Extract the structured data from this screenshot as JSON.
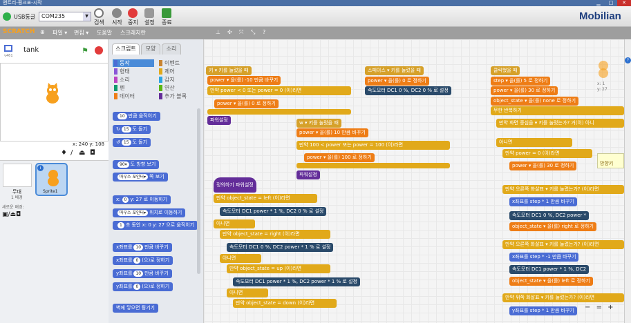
{
  "window": {
    "title": "엔트리-핑크포-시작"
  },
  "toolbar": {
    "port_label": "USB통글",
    "port_value": "COM235",
    "search_label": "검색",
    "start_label": "시작",
    "stop_label": "중지",
    "settings_label": "설정",
    "exit_label": "종료",
    "brand": "Mobilian"
  },
  "menubar": {
    "logo": "SCRATCH",
    "file": "파일 ▾",
    "edit": "편집 ▾",
    "help": "도움말",
    "about": "스크래치란"
  },
  "stage": {
    "sprite_name": "tank",
    "version": "v461",
    "coord_x_label": "x:",
    "coord_x": "240",
    "coord_y_label": "y:",
    "coord_y": "108"
  },
  "sprites": {
    "stage_label": "무대",
    "stage_sub": "1 배경",
    "new_backdrop": "새로운 배경:",
    "sprite1": "Sprite1"
  },
  "tabs": {
    "scripts": "스크립트",
    "costumes": "모양",
    "sounds": "소리"
  },
  "categories": [
    {
      "label": "동작",
      "color": "#4a6cd4"
    },
    {
      "label": "이벤트",
      "color": "#c88330"
    },
    {
      "label": "형태",
      "color": "#8a55d7"
    },
    {
      "label": "제어",
      "color": "#e1a91a"
    },
    {
      "label": "소리",
      "color": "#bb42c3"
    },
    {
      "label": "감지",
      "color": "#2ca5e2"
    },
    {
      "label": "펜",
      "color": "#0e9a6c"
    },
    {
      "label": "연산",
      "color": "#5cb712"
    },
    {
      "label": "데이터",
      "color": "#ee7d16"
    },
    {
      "label": "추가 블록",
      "color": "#632d99"
    }
  ],
  "palette_blocks": [
    {
      "pre": "",
      "val": "10",
      "post": "만큼 움직이기"
    },
    {
      "pre": "↻",
      "val": "15",
      "post": "도 돌기"
    },
    {
      "pre": "↺",
      "val": "15",
      "post": "도 돌기"
    },
    {
      "pre": "",
      "val": "90▾",
      "post": "도 방향 보기"
    },
    {
      "pre": "",
      "val": "마우스 포인터▾",
      "post": "쪽 보기"
    },
    {
      "pre": "x:",
      "val": "0",
      "post": "y: 27 로 이동하기"
    },
    {
      "pre": "",
      "val": "마우스 포인터▾",
      "post": "위치로 이동하기"
    },
    {
      "pre": "",
      "val": "1",
      "post": "초 동안 x: 0 y: 27 으로 움직이기"
    },
    {
      "pre": "x좌표를",
      "val": "10",
      "post": "만큼 바꾸기"
    },
    {
      "pre": "x좌표를",
      "val": "0",
      "post": "(으)로 정하기"
    },
    {
      "pre": "y좌표를",
      "val": "10",
      "post": "만큼 바꾸기"
    },
    {
      "pre": "y좌표를",
      "val": "0",
      "post": "(으)로 정하기"
    },
    {
      "pre": "",
      "val": "",
      "post": "벽에 닿으면 튕기기"
    }
  ],
  "scripts": {
    "s1": {
      "hat": "키 ▾ 키를 눌렀을 때",
      "l1": "power ▾ 을(를) -10 만큼 바꾸기",
      "l2": "만약 power < 0 또는 power = 0 (이)라면",
      "l3": "power ▾ 을(를) 0 로 정하기",
      "end": "파워설정"
    },
    "s2": {
      "hat": "스페이스 ▾ 키를 눌렀을 때",
      "l1": "power ▾ 을(를) 0 로 정하기",
      "l2": "속도모터 DC1 0 %, DC2 0 % 로 설정"
    },
    "s3": {
      "hat": "w ▾ 키를 눌렀을 때",
      "l1": "power ▾ 을(를) 10 만큼 바꾸기",
      "l2": "만약 100 < power 또는 power = 100 (이)라면",
      "l3": "power ▾ 을(를) 100 로 정하기",
      "end": "파워설정"
    },
    "s4": {
      "hat": "클릭했을 때",
      "l1": "step ▾ 을(를) 5 로 정하기",
      "l2": "power ▾ 을(를) 30 로 정하기",
      "l3": "object_state ▾ 을(를) none 로 정하기",
      "l4": "무한 반복하기",
      "l5": "만약 화면 중심을 ▾ 키를 눌렀는가? 거(이) 아니",
      "l6": "아니면",
      "l7": "만약 power = 0 (이)라면",
      "l8": "power ▾ 을(를) 30 로 정하기",
      "l9": "만약 오른쪽 화살표 ▾ 키를 눌렀는가? (이)라면",
      "l10": "x좌표를 step * 1 만큼 바꾸기",
      "l11": "속도모터 DC1 0 %, DC2 power *",
      "l12": "object_state ▾ 을(를) right 로 정하기",
      "l13": "만약 오른쪽 화살표 ▾ 키를 눌렀는가? (이)라면",
      "l14": "x좌표를 step * -1 만큼 바꾸기",
      "l15": "속도모터 DC1 power * 1 %, DC2",
      "l16": "object_state ▾ 을(를) left 로 정하기",
      "l17": "만약 위쪽 화살표 ▾ 키를 눌렀는가? (이)라면",
      "l18": "y좌표를 step * 1 만큼 바꾸기",
      "tooltip": "방향키"
    },
    "s5": {
      "hat": "정의하기 파워설정",
      "l1": "만약 object_state = left (이)라면",
      "l2": "속도모터 DC1 power * 1 %, DC2 0 % 로 설정",
      "l3": "아니면",
      "l4": "만약 object_state = right (이)라면",
      "l5": "속도모터 DC1 0 %, DC2 power * 1 % 로 설정",
      "l6": "아니면",
      "l7": "만약 object_state = up (이)라면",
      "l8": "속도모터 DC1 power * 1 %, DC2 power * 1 % 로 설정",
      "l9": "아니면",
      "l10": "만약 object_state = down (이)라면"
    },
    "sprite_coord_x": "x: 1",
    "sprite_coord_y": "y: 27"
  },
  "zoom": {
    "out": "−",
    "reset": "=",
    "in": "+"
  },
  "colors": {
    "accent": "#4a6cd4",
    "control": "#e1a91a",
    "operator": "#5cb712",
    "variable": "#ee7d16",
    "extension": "#2a4a6a",
    "custom": "#632d99"
  }
}
